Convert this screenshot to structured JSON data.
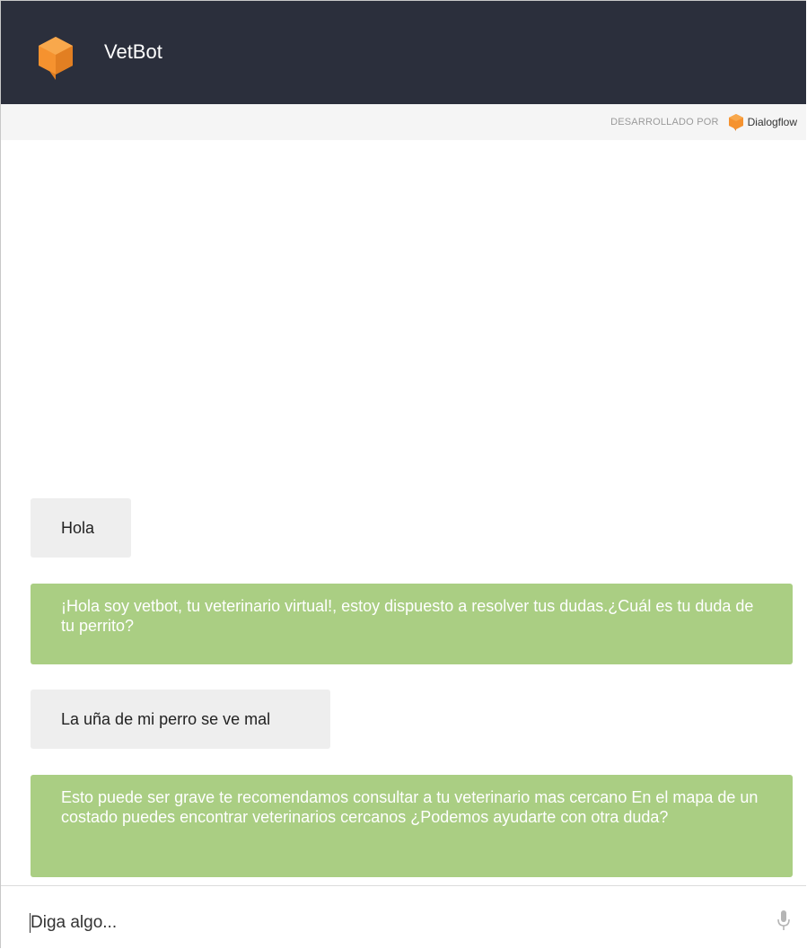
{
  "header": {
    "title": "VetBot",
    "logo_icon": "orange-cube-icon",
    "background": "#2b2f3c"
  },
  "powered_by": {
    "label": "DESARROLLADO POR",
    "brand": "Dialogflow",
    "brand_icon": "dialogflow-icon"
  },
  "messages": [
    {
      "role": "user",
      "text": "Hola"
    },
    {
      "role": "bot",
      "text": "¡Hola soy vetbot, tu veterinario virtual!, estoy dispuesto a resolver tus dudas.¿Cuál es tu duda de tu perrito?"
    },
    {
      "role": "user",
      "text": "La uña de mi perro se ve mal"
    },
    {
      "role": "bot",
      "text": "Esto puede ser grave te recomendamos consultar a tu veterinario mas cercano En el mapa de un costado puedes encontrar veterinarios cercanos ¿Podemos ayudarte con otra duda?"
    }
  ],
  "input": {
    "placeholder": "Diga algo...",
    "mic_icon": "microphone-icon"
  },
  "colors": {
    "user_bubble": "#eeeeee",
    "bot_bubble": "#aace83",
    "accent": "#f5922f"
  }
}
